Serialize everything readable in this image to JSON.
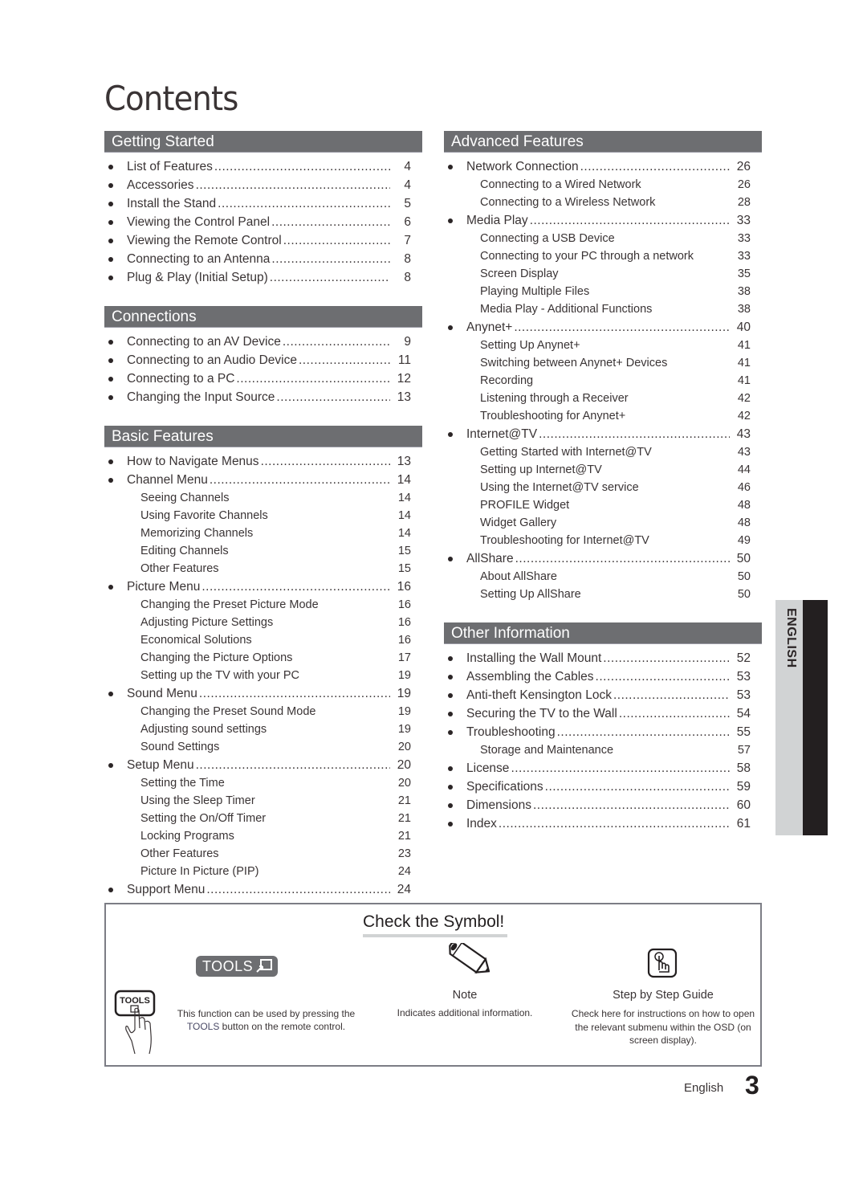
{
  "page_title": "Contents",
  "left_column": [
    {
      "title": "Getting Started",
      "items": [
        {
          "label": "List of Features",
          "page": "4",
          "level": "main"
        },
        {
          "label": "Accessories",
          "page": "4",
          "level": "main"
        },
        {
          "label": "Install the Stand",
          "page": "5",
          "level": "main"
        },
        {
          "label": "Viewing the Control Panel",
          "page": "6",
          "level": "main"
        },
        {
          "label": "Viewing the Remote Control",
          "page": "7",
          "level": "main"
        },
        {
          "label": "Connecting to an Antenna",
          "page": "8",
          "level": "main"
        },
        {
          "label": "Plug & Play (Initial Setup)",
          "page": "8",
          "level": "main"
        }
      ]
    },
    {
      "title": "Connections",
      "items": [
        {
          "label": "Connecting to an AV Device",
          "page": "9",
          "level": "main"
        },
        {
          "label": "Connecting to an Audio Device",
          "page": "11",
          "level": "main"
        },
        {
          "label": "Connecting to a PC",
          "page": "12",
          "level": "main"
        },
        {
          "label": "Changing the Input Source",
          "page": "13",
          "level": "main"
        }
      ]
    },
    {
      "title": "Basic Features",
      "items": [
        {
          "label": "How to Navigate Menus",
          "page": "13",
          "level": "main"
        },
        {
          "label": "Channel Menu",
          "page": "14",
          "level": "main"
        },
        {
          "label": "Seeing Channels",
          "page": "14",
          "level": "sub"
        },
        {
          "label": "Using Favorite Channels",
          "page": "14",
          "level": "sub"
        },
        {
          "label": "Memorizing Channels",
          "page": "14",
          "level": "sub"
        },
        {
          "label": "Editing Channels",
          "page": "15",
          "level": "sub"
        },
        {
          "label": "Other Features",
          "page": "15",
          "level": "sub"
        },
        {
          "label": "Picture Menu",
          "page": "16",
          "level": "main"
        },
        {
          "label": "Changing the Preset Picture Mode",
          "page": "16",
          "level": "sub"
        },
        {
          "label": "Adjusting Picture Settings",
          "page": "16",
          "level": "sub"
        },
        {
          "label": "Economical Solutions",
          "page": "16",
          "level": "sub"
        },
        {
          "label": "Changing the Picture Options",
          "page": "17",
          "level": "sub"
        },
        {
          "label": "Setting up the TV with your PC",
          "page": "19",
          "level": "sub"
        },
        {
          "label": "Sound Menu",
          "page": "19",
          "level": "main"
        },
        {
          "label": "Changing the Preset Sound Mode",
          "page": "19",
          "level": "sub"
        },
        {
          "label": "Adjusting sound settings",
          "page": "19",
          "level": "sub"
        },
        {
          "label": "Sound Settings",
          "page": "20",
          "level": "sub"
        },
        {
          "label": "Setup Menu",
          "page": "20",
          "level": "main"
        },
        {
          "label": "Setting the Time",
          "page": "20",
          "level": "sub"
        },
        {
          "label": "Using the Sleep Timer",
          "page": "21",
          "level": "sub"
        },
        {
          "label": "Setting the On/Off Timer",
          "page": "21",
          "level": "sub"
        },
        {
          "label": "Locking Programs",
          "page": "21",
          "level": "sub"
        },
        {
          "label": "Other Features",
          "page": "23",
          "level": "sub"
        },
        {
          "label": "Picture In Picture (PIP)",
          "page": "24",
          "level": "sub"
        },
        {
          "label": "Support Menu",
          "page": "24",
          "level": "main"
        }
      ]
    }
  ],
  "right_column": [
    {
      "title": "Advanced Features",
      "items": [
        {
          "label": "Network Connection",
          "page": "26",
          "level": "main"
        },
        {
          "label": "Connecting to a Wired Network",
          "page": "26",
          "level": "sub"
        },
        {
          "label": "Connecting to a Wireless Network",
          "page": "28",
          "level": "sub"
        },
        {
          "label": "Media Play",
          "page": "33",
          "level": "main"
        },
        {
          "label": "Connecting a USB Device",
          "page": "33",
          "level": "sub"
        },
        {
          "label": "Connecting to your PC through a network",
          "page": "33",
          "level": "sub"
        },
        {
          "label": "Screen Display",
          "page": "35",
          "level": "sub"
        },
        {
          "label": "Playing Multiple Files",
          "page": "38",
          "level": "sub"
        },
        {
          "label": "Media Play - Additional Functions",
          "page": "38",
          "level": "sub"
        },
        {
          "label": "Anynet+",
          "page": "40",
          "level": "main"
        },
        {
          "label": "Setting Up Anynet+",
          "page": "41",
          "level": "sub"
        },
        {
          "label": "Switching between Anynet+ Devices",
          "page": "41",
          "level": "sub"
        },
        {
          "label": "Recording",
          "page": "41",
          "level": "sub"
        },
        {
          "label": "Listening through a Receiver",
          "page": "42",
          "level": "sub"
        },
        {
          "label": "Troubleshooting for Anynet+",
          "page": "42",
          "level": "sub"
        },
        {
          "label": "Internet@TV",
          "page": "43",
          "level": "main"
        },
        {
          "label": "Getting Started with Internet@TV",
          "page": "43",
          "level": "sub"
        },
        {
          "label": "Setting up Internet@TV",
          "page": "44",
          "level": "sub"
        },
        {
          "label": "Using the Internet@TV service",
          "page": "46",
          "level": "sub"
        },
        {
          "label": "PROFILE Widget",
          "page": "48",
          "level": "sub"
        },
        {
          "label": "Widget Gallery",
          "page": "48",
          "level": "sub"
        },
        {
          "label": "Troubleshooting for Internet@TV",
          "page": "49",
          "level": "sub"
        },
        {
          "label": "AllShare",
          "page": "50",
          "level": "main"
        },
        {
          "label": "About AllShare",
          "page": "50",
          "level": "sub"
        },
        {
          "label": "Setting Up AllShare",
          "page": "50",
          "level": "sub"
        }
      ]
    },
    {
      "title": "Other Information",
      "items": [
        {
          "label": "Installing the Wall Mount",
          "page": "52",
          "level": "main"
        },
        {
          "label": "Assembling the Cables",
          "page": "53",
          "level": "main"
        },
        {
          "label": "Anti-theft Kensington Lock",
          "page": "53",
          "level": "main"
        },
        {
          "label": "Securing the TV to the Wall",
          "page": "54",
          "level": "main"
        },
        {
          "label": "Troubleshooting",
          "page": "55",
          "level": "main"
        },
        {
          "label": "Storage and Maintenance",
          "page": "57",
          "level": "sub"
        },
        {
          "label": "License",
          "page": "58",
          "level": "main"
        },
        {
          "label": "Specifications",
          "page": "59",
          "level": "main"
        },
        {
          "label": "Dimensions",
          "page": "60",
          "level": "main"
        },
        {
          "label": "Index",
          "page": "61",
          "level": "main"
        }
      ]
    }
  ],
  "side_tab": {
    "label": "ENGLISH"
  },
  "symbol_box": {
    "title": "Check the Symbol!",
    "tools": {
      "badge_label": "TOOLS",
      "button_label": "TOOLS",
      "desc_line1": "This function can be used by pressing the",
      "desc_keyword": "TOOLS",
      "desc_line2_rest": " button on the remote control.",
      "icon": "tools-hand-icon"
    },
    "note": {
      "label": "Note",
      "desc": "Indicates additional information.",
      "icon": "pencil-icon"
    },
    "guide": {
      "label": "Step by Step Guide",
      "desc": "Check here for instructions on how to open the relevant submenu within the OSD (on screen display).",
      "icon": "finger-press-icon"
    }
  },
  "footer": {
    "language": "English",
    "page_number": "3"
  },
  "colors": {
    "section_header": "#6d6e71",
    "side_tab_light": "#d1d3d4",
    "side_tab_dark": "#231f20",
    "text": "#3a3435"
  }
}
